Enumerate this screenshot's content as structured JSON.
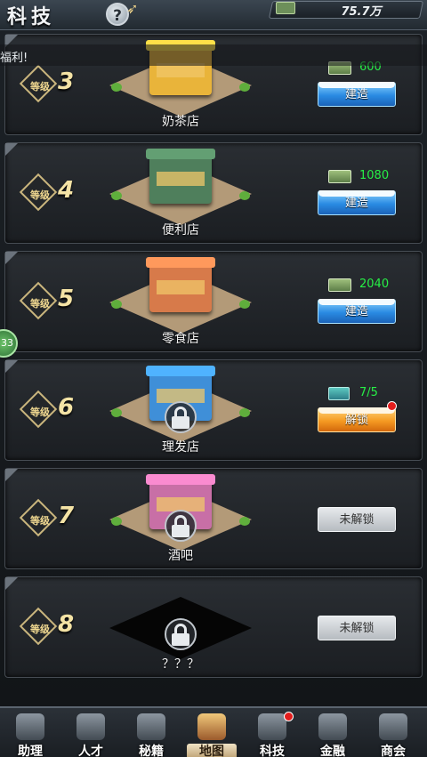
{
  "header": {
    "title": "科技",
    "help_label": "?",
    "money": "75.7万",
    "money_icon": "cash-stack-icon"
  },
  "marquee": {
    "text": "福利!"
  },
  "side_badge": {
    "text": "33"
  },
  "shops": [
    {
      "level_label": "等级",
      "level": "3",
      "name": "奶茶店",
      "cost_icon": "cash-icon",
      "cost": "600",
      "button": "建造",
      "button_style": "blue",
      "locked": false,
      "color": "#e9b43a"
    },
    {
      "level_label": "等级",
      "level": "4",
      "name": "便利店",
      "cost_icon": "cash-icon",
      "cost": "1080",
      "button": "建造",
      "button_style": "blue",
      "locked": false,
      "color": "#4f7f5c"
    },
    {
      "level_label": "等级",
      "level": "5",
      "name": "零食店",
      "cost_icon": "cash-icon",
      "cost": "2040",
      "button": "建造",
      "button_style": "blue",
      "locked": false,
      "color": "#d77a4a"
    },
    {
      "level_label": "等级",
      "level": "6",
      "name": "理发店",
      "cost_icon": "ticket-icon",
      "cost": "7/5",
      "button": "解锁",
      "button_style": "orange",
      "locked": true,
      "has_dot": true,
      "color": "#3f8fd8"
    },
    {
      "level_label": "等级",
      "level": "7",
      "name": "酒吧",
      "cost_icon": "",
      "cost": "",
      "button": "未解锁",
      "button_style": "gray",
      "locked": true,
      "color": "#c86fa6"
    },
    {
      "level_label": "等级",
      "level": "8",
      "name": "？？？",
      "cost_icon": "",
      "cost": "",
      "button": "未解锁",
      "button_style": "gray",
      "locked": true,
      "dark": true,
      "color": "#050505"
    }
  ],
  "nav": [
    {
      "label": "助理",
      "icon": "assistant-icon",
      "active": false,
      "dot": false
    },
    {
      "label": "人才",
      "icon": "talent-icon",
      "active": false,
      "dot": false
    },
    {
      "label": "秘籍",
      "icon": "secret-book-icon",
      "active": false,
      "dot": false
    },
    {
      "label": "地图",
      "icon": "map-icon",
      "active": true,
      "dot": false
    },
    {
      "label": "科技",
      "icon": "tech-icon",
      "active": false,
      "dot": true
    },
    {
      "label": "金融",
      "icon": "finance-icon",
      "active": false,
      "dot": false
    },
    {
      "label": "商会",
      "icon": "chamber-icon",
      "active": false,
      "dot": false
    }
  ]
}
